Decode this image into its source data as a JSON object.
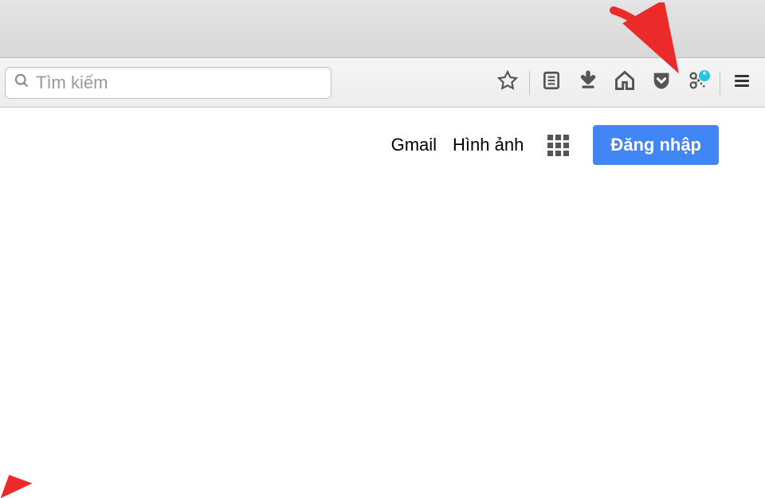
{
  "toolbar": {
    "search_placeholder": "Tìm kiếm",
    "icons": {
      "search": "search-icon",
      "star": "star-icon",
      "reading_list": "reading-list-icon",
      "download": "download-icon",
      "home": "home-icon",
      "pocket": "pocket-icon",
      "screenshot": "screenshot-icon",
      "menu": "hamburger-menu-icon"
    },
    "screenshot_badge": "*"
  },
  "page": {
    "nav": {
      "gmail_label": "Gmail",
      "images_label": "Hình ảnh",
      "signin_label": "Đăng nhập"
    }
  }
}
